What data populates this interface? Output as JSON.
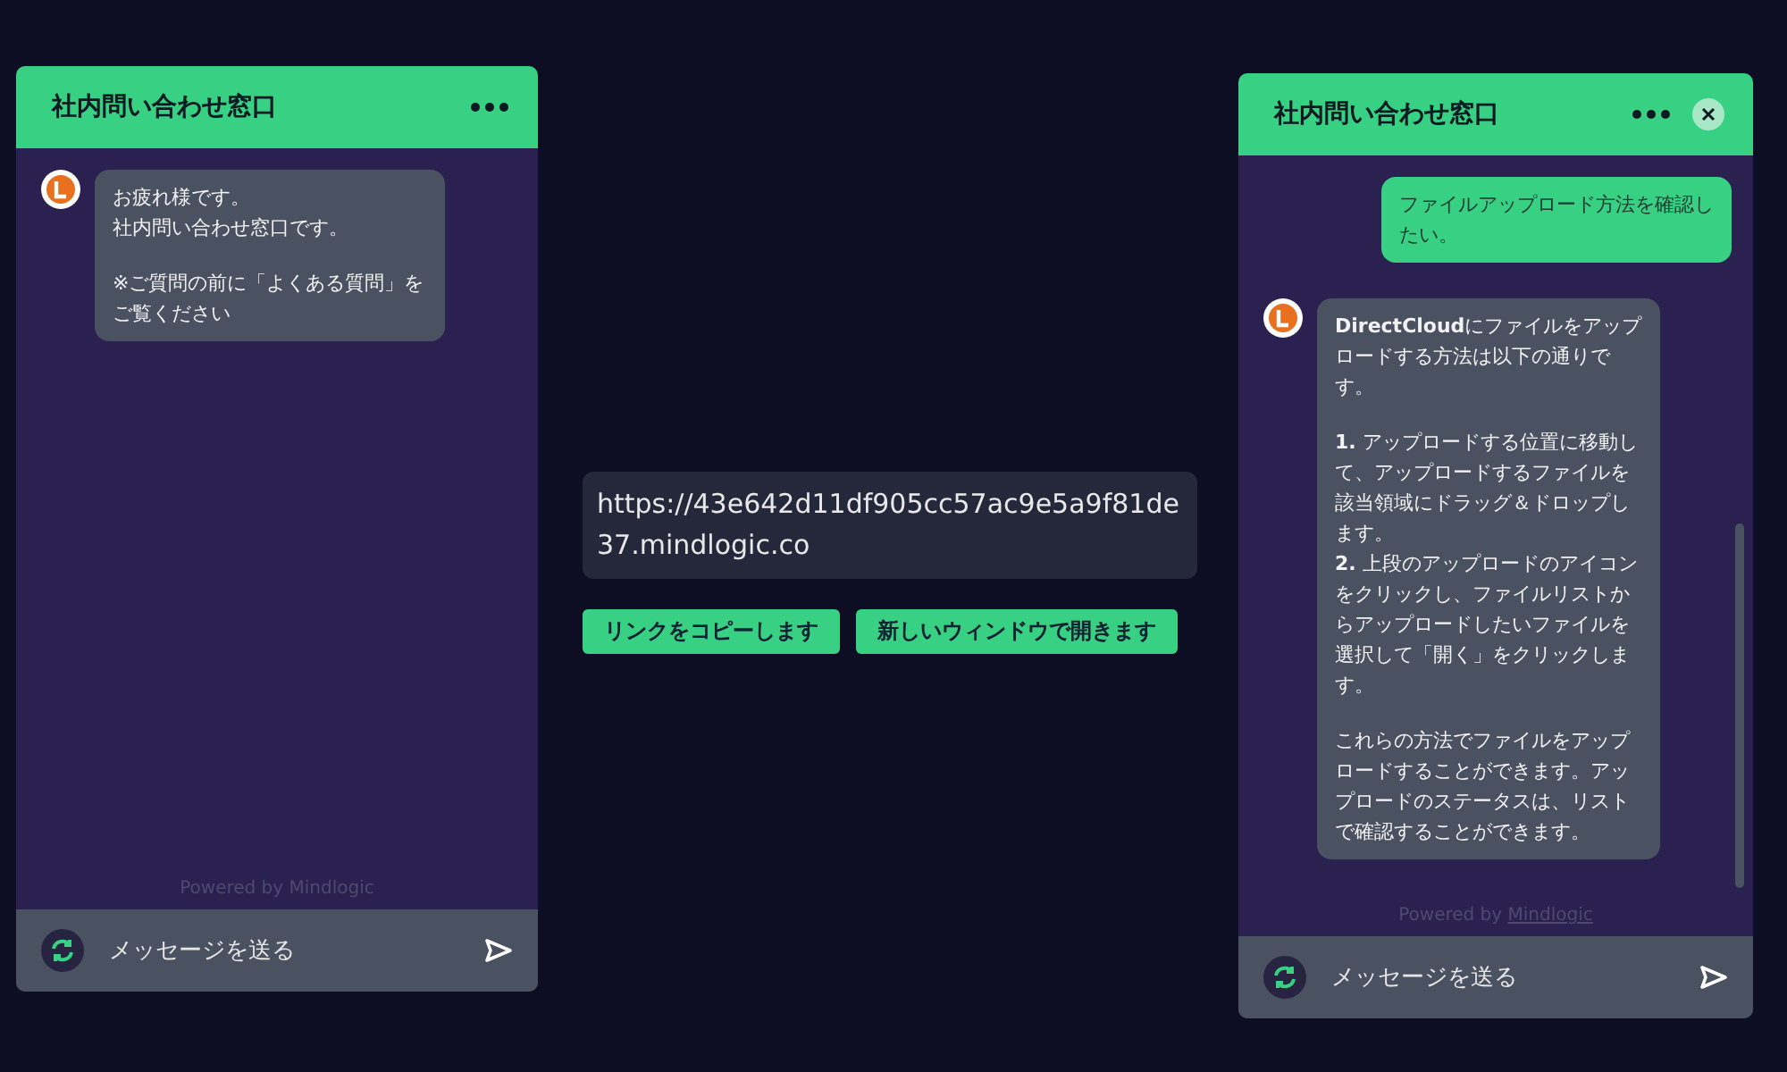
{
  "left_widget": {
    "title": "社内問い合わせ窓口",
    "has_close": false,
    "scrollbar": false,
    "messages": [
      {
        "kind": "bot",
        "paragraphs": [
          [
            "お疲れ様です。",
            "社内問い合わせ窓口です。"
          ],
          [
            "※ご質問の前に「よくある質問」をご覧ください"
          ]
        ]
      }
    ],
    "powered": {
      "prefix": "Powered by",
      "brand": "Mindlogic",
      "brand_link": false
    },
    "input": {
      "placeholder": "メッセージを送る"
    }
  },
  "link_panel": {
    "url": "https://43e642d11df905cc57ac9e5a9f81de37.mindlogic.co",
    "buttons": [
      "リンクをコピーします",
      "新しいウィンドウで開きます"
    ]
  },
  "right_widget": {
    "title": "社内問い合わせ窓口",
    "has_close": true,
    "scrollbar": true,
    "messages": [
      {
        "kind": "user",
        "paragraphs": [
          [
            "ファイルアップロード方法を確認したい。"
          ]
        ]
      },
      {
        "kind": "bot",
        "paragraphs": [
          [
            "**DirectCloud**にファイルをアップロードする方法は以下の通りです。"
          ],
          [
            "**1.** アップロードする位置に移動して、アップロードするファイルを該当領域にドラッグ＆ドロップします。",
            "**2.** 上段のアップロードのアイコンをクリックし、ファイルリストからアップロードしたいファイルを選択して「開く」をクリックします。"
          ],
          [
            "これらの方法でファイルをアップロードすることができます。アップロードのステータスは、リストで確認することができます。"
          ]
        ]
      }
    ],
    "powered": {
      "prefix": "Powered by",
      "brand": "Mindlogic",
      "brand_link": true
    },
    "input": {
      "placeholder": "メッセージを送る"
    }
  }
}
